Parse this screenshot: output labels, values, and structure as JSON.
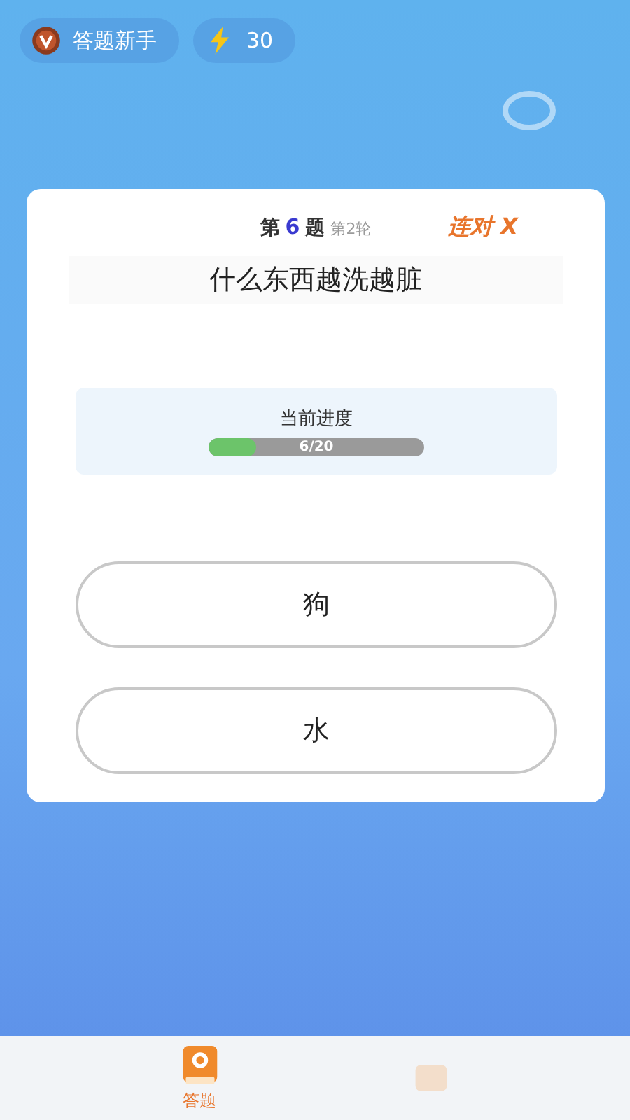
{
  "status": {
    "rank": "答题新手",
    "energy": "30"
  },
  "card": {
    "prefix": "第",
    "number": "6",
    "suffix": "题",
    "round": "第2轮",
    "streak": "连对 X",
    "question": "什么东西越洗越脏",
    "progress": {
      "label": "当前进度",
      "level": 0.22,
      "reading": "6/20"
    },
    "options": [
      {
        "text": "狗"
      },
      {
        "text": "水"
      }
    ]
  },
  "tabs": [
    {
      "label": "答题",
      "selected": true
    },
    {
      "selected": false
    }
  ]
}
